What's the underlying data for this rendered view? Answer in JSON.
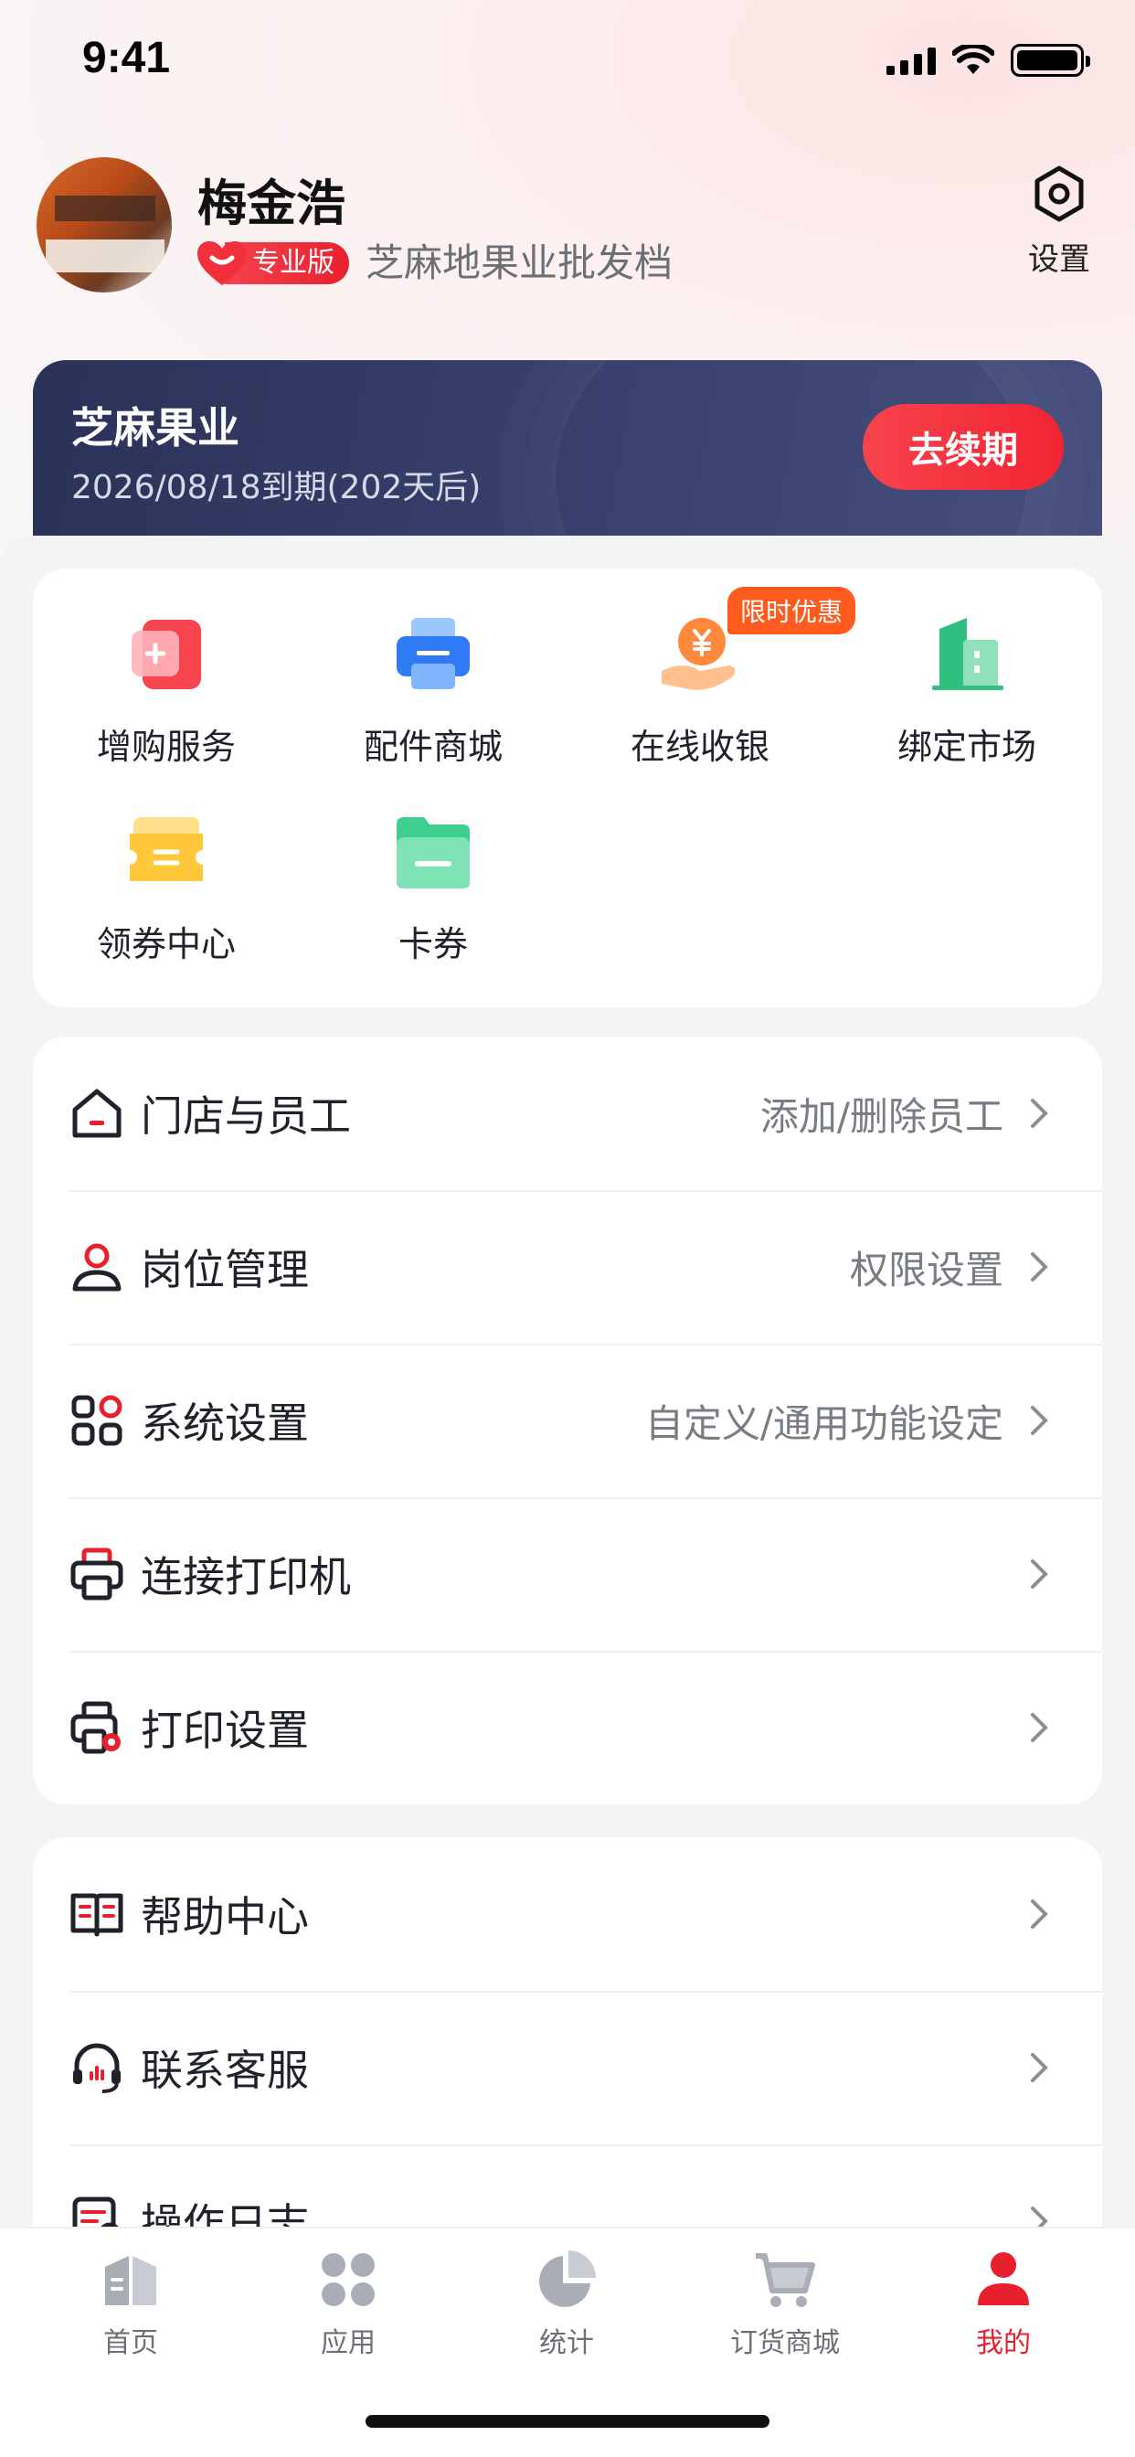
{
  "status_bar": {
    "time": "9:41"
  },
  "profile": {
    "name": "梅金浩",
    "badge": "专业版",
    "shop": "芝麻地果业批发档",
    "settings_label": "设置"
  },
  "vip": {
    "title": "芝麻果业",
    "expire": "2026/08/18到期(202天后)",
    "renew_label": "去续期"
  },
  "quick_actions": {
    "promo_tag": "限时优惠",
    "items": [
      {
        "label": "增购服务",
        "icon": "add-service-icon"
      },
      {
        "label": "配件商城",
        "icon": "printer-mall-icon"
      },
      {
        "label": "在线收银",
        "icon": "cashier-icon"
      },
      {
        "label": "绑定市场",
        "icon": "building-icon"
      },
      {
        "label": "领券中心",
        "icon": "coupon-icon"
      },
      {
        "label": "卡券",
        "icon": "card-icon"
      }
    ]
  },
  "menu_group_1": [
    {
      "title": "门店与员工",
      "hint": "添加/删除员工",
      "icon": "store-icon"
    },
    {
      "title": "岗位管理",
      "hint": "权限设置",
      "icon": "user-icon"
    },
    {
      "title": "系统设置",
      "hint": "自定义/通用功能设定",
      "icon": "grid-icon"
    },
    {
      "title": "连接打印机",
      "hint": "",
      "icon": "printer-icon"
    },
    {
      "title": "打印设置",
      "hint": "",
      "icon": "printer-settings-icon"
    }
  ],
  "menu_group_2": [
    {
      "title": "帮助中心",
      "hint": "",
      "icon": "book-icon"
    },
    {
      "title": "联系客服",
      "hint": "",
      "icon": "headset-icon"
    },
    {
      "title": "操作日志",
      "hint": "",
      "icon": "log-icon"
    }
  ],
  "tab_bar": {
    "active": "我的",
    "tabs": [
      {
        "label": "首页",
        "icon": "home-icon"
      },
      {
        "label": "应用",
        "icon": "apps-icon"
      },
      {
        "label": "统计",
        "icon": "pie-chart-icon"
      },
      {
        "label": "订货商城",
        "icon": "cart-icon"
      },
      {
        "label": "我的",
        "icon": "profile-icon"
      }
    ]
  },
  "colors": {
    "accent": "#e8202e",
    "card_dark": "#2b3258",
    "promo": "#ff5b1f"
  }
}
